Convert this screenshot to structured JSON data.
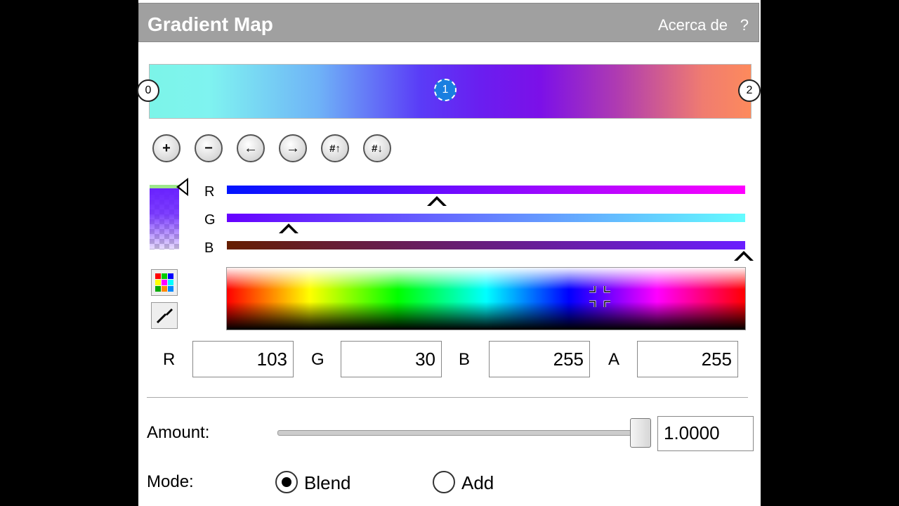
{
  "header": {
    "title": "Gradient Map",
    "about_label": "Acerca de",
    "help_label": "?"
  },
  "gradient": {
    "stops": [
      {
        "label": "0",
        "color": "#7cf4e8"
      },
      {
        "label": "1",
        "color": "#671eff",
        "selected": true
      },
      {
        "label": "2",
        "color": "#fd8a5c"
      }
    ]
  },
  "toolbar": {
    "buttons": [
      {
        "name": "add-stop",
        "glyph": "+"
      },
      {
        "name": "remove-stop",
        "glyph": "−"
      },
      {
        "name": "move-left",
        "glyph": "←"
      },
      {
        "name": "move-right",
        "glyph": "→"
      },
      {
        "name": "hash-up",
        "glyph": "#↑"
      },
      {
        "name": "hash-down",
        "glyph": "#↓"
      }
    ]
  },
  "channels": {
    "r_label": "R",
    "g_label": "G",
    "b_label": "B"
  },
  "color_values": {
    "r_label": "R",
    "r": "103",
    "g_label": "G",
    "g": "30",
    "b_label": "B",
    "b": "255",
    "a_label": "A",
    "a": "255"
  },
  "amount": {
    "label": "Amount:",
    "value": "1.0000",
    "fraction": 1.0
  },
  "mode": {
    "label": "Mode:",
    "options": [
      {
        "label": "Blend",
        "selected": true
      },
      {
        "label": "Add",
        "selected": false
      }
    ]
  }
}
